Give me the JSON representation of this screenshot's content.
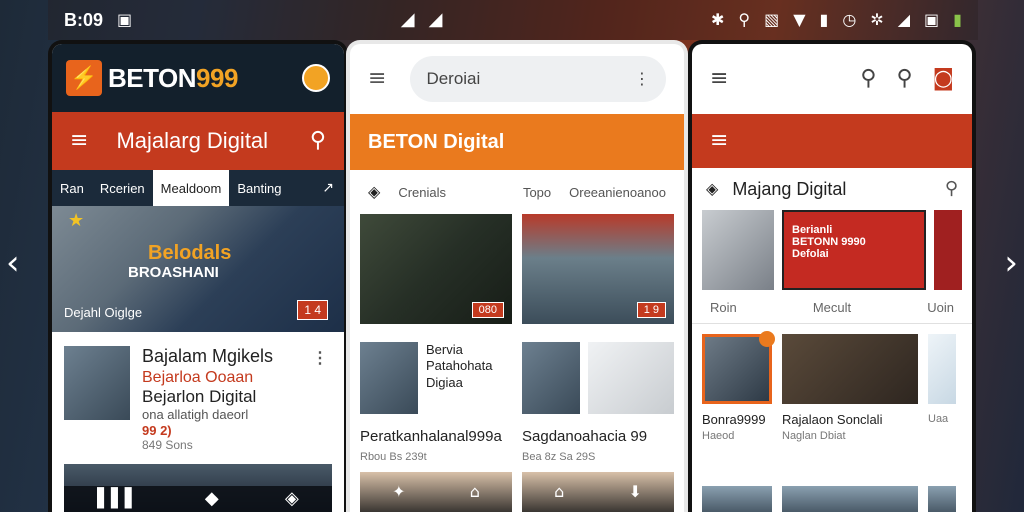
{
  "status_bar": {
    "time": "B:09"
  },
  "phone1": {
    "brand": {
      "name_prefix": "BETON",
      "name_suffix": "999"
    },
    "appbar": {
      "title": "Majalarg Digital"
    },
    "tabs": [
      "Ran",
      "Rcerien",
      "Mealdoom",
      "Banting"
    ],
    "hero": {
      "watermark1": "Belodals",
      "watermark2": "BROASHANI",
      "caption": "Dejahl Oiglge",
      "badge": "1 4"
    },
    "featured": {
      "title": "Bajalam Mgikels",
      "subtitle": "Bejarloa Ooaan",
      "title2": "Bejarlon Digital",
      "desc": "ona allatigh daeorl",
      "number": "99 2)",
      "meta": "849 Sons"
    }
  },
  "phone2": {
    "search": {
      "placeholder": "Deroiai"
    },
    "appbar": {
      "title": "BETON Digital"
    },
    "filters": {
      "left": "Crenials",
      "mid": "Topo",
      "right": "Oreeanienoanoo"
    },
    "cards": [
      {
        "badge": "080"
      },
      {
        "badge": "1 9"
      }
    ],
    "items": [
      {
        "line1": "Bervia",
        "line2": "Patahohata",
        "line3": "Digiaa",
        "title": "Peratkanhalanal999a",
        "meta": "Rbou Bs 239t"
      },
      {
        "title": "Sagdanoahacia 99",
        "meta": "Bea 8z Sa 29S"
      }
    ]
  },
  "phone3": {
    "title": "Majang Digital",
    "hero_text": {
      "line1": "Berianli",
      "line2": "BETONN 9990",
      "line3": "Defolai"
    },
    "labels": [
      "Roin",
      "Mecult",
      "Uoin"
    ],
    "items": [
      {
        "title": "Bonra9999",
        "sub": "Haeod"
      },
      {
        "title": "Rajalaon Sonclali",
        "sub": "Naglan Dbiat"
      },
      {
        "title": "",
        "sub": "Uaa"
      }
    ]
  },
  "colors": {
    "brand_orange": "#e8641c",
    "brand_red": "#c43a1e",
    "brand_yellow": "#f2a324",
    "navy": "#13202c"
  }
}
